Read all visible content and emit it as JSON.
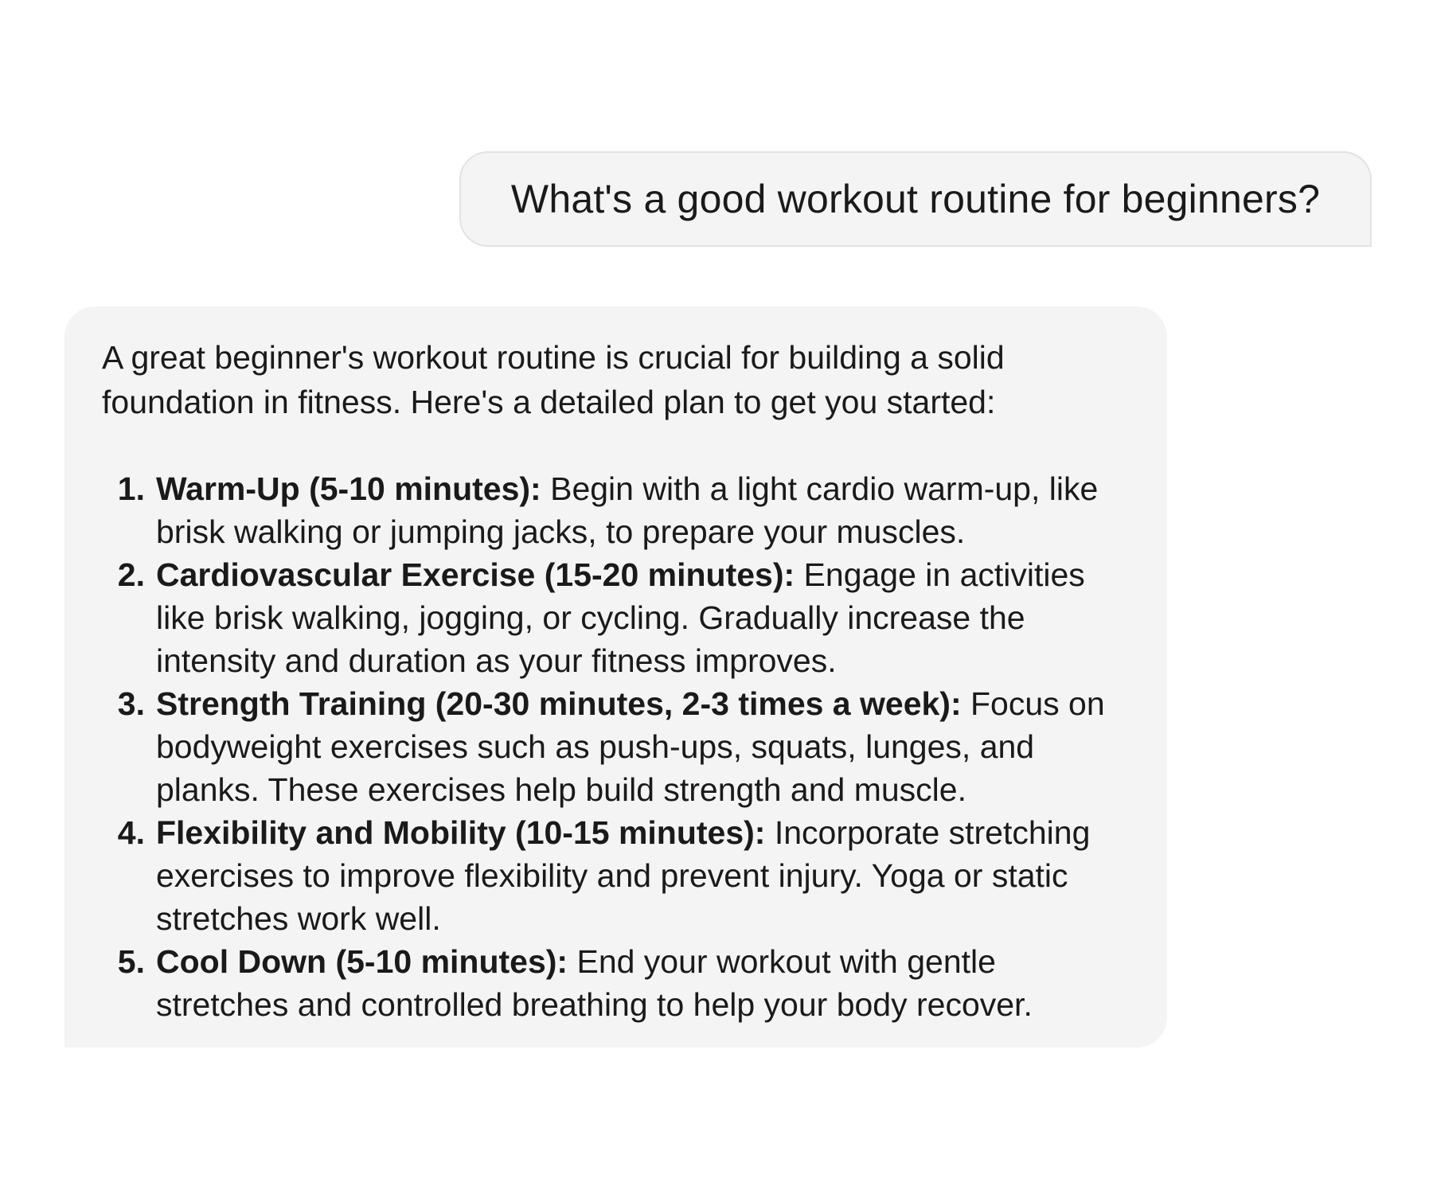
{
  "conversation": {
    "user_message": "What's a good workout routine for beginners?",
    "assistant": {
      "intro": "A great beginner's workout routine is crucial for building a solid foundation in fitness. Here's a detailed plan to get you started:",
      "steps": [
        {
          "number": "1.",
          "title": "Warm-Up (5-10 minutes):",
          "text": " Begin with a light cardio warm-up, like brisk walking or jumping jacks, to prepare your muscles."
        },
        {
          "number": "2.",
          "title": "Cardiovascular Exercise (15-20 minutes):",
          "text": " Engage in activities like brisk walking, jogging, or cycling. Gradually increase the intensity and duration as your fitness improves."
        },
        {
          "number": "3.",
          "title": "Strength Training (20-30 minutes, 2-3 times a week):",
          "text": " Focus on bodyweight exercises such as push-ups, squats, lunges, and planks. These exercises help build strength and muscle."
        },
        {
          "number": "4.",
          "title": "Flexibility and Mobility (10-15 minutes):",
          "text": " Incorporate stretching exercises to improve flexibility and prevent injury. Yoga or static stretches work well."
        },
        {
          "number": "5.",
          "title": "Cool Down (5-10 minutes):",
          "text": " End your workout with gentle stretches and controlled breathing to help your body recover."
        }
      ]
    }
  },
  "colors": {
    "bubble_background": "#f4f4f4",
    "user_bubble_border": "#e3e3e3",
    "text": "#1a1a1a",
    "page_background": "#ffffff"
  }
}
